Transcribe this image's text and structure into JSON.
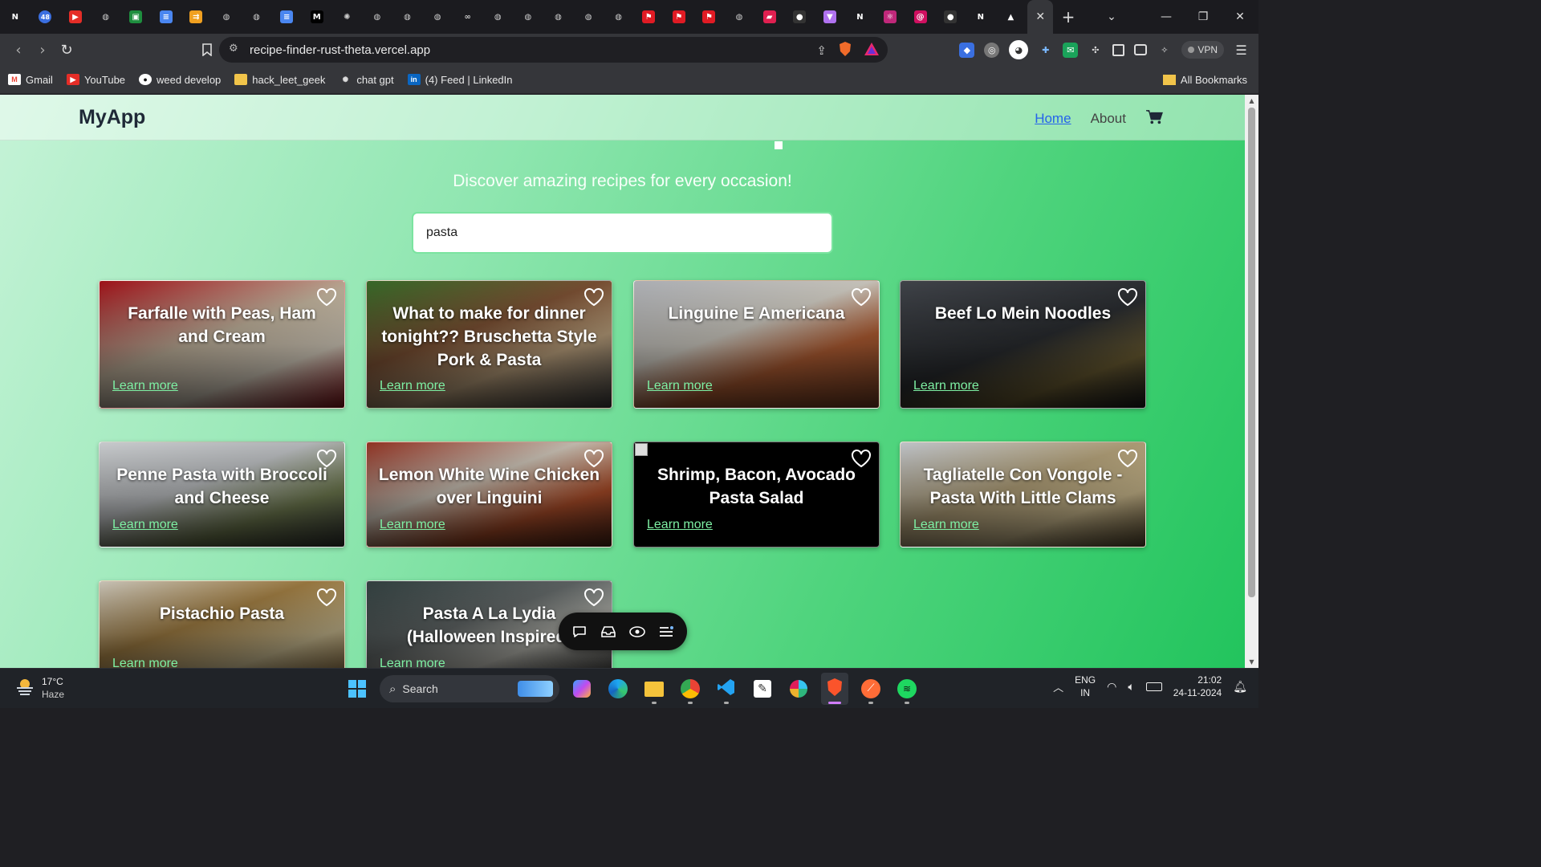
{
  "browser": {
    "tab_count": 35,
    "tabs_icons": [
      "notion-icon",
      "calendar-icon",
      "youtube-icon",
      "globe-icon",
      "classroom-icon",
      "docs-icon",
      "arrow-icon",
      "globe-icon",
      "globe-icon",
      "docs-icon",
      "medium-icon",
      "openai-icon",
      "globe-icon",
      "globe-icon",
      "globe-icon",
      "link-icon",
      "globe-icon",
      "globe-icon",
      "globe-icon",
      "globe-icon",
      "globe-icon",
      "gfg-icon",
      "gfg-icon",
      "gfg-icon",
      "globe-icon",
      "brand-icon",
      "github-icon",
      "vercel-v-icon",
      "notion-icon",
      "react-icon",
      "debian-icon",
      "github-icon",
      "notion-icon",
      "vercel-icon"
    ],
    "url": "recipe-finder-rust-theta.vercel.app",
    "vpn_label": "VPN",
    "bookmarks": [
      {
        "label": "Gmail",
        "icon": "gmail-icon"
      },
      {
        "label": "YouTube",
        "icon": "youtube-icon"
      },
      {
        "label": "weed develop",
        "icon": "github-icon"
      },
      {
        "label": "hack_leet_geek",
        "icon": "folder-icon"
      },
      {
        "label": "chat gpt",
        "icon": "openai-icon"
      },
      {
        "label": "(4) Feed | LinkedIn",
        "icon": "linkedin-icon"
      }
    ],
    "all_bookmarks": "All Bookmarks",
    "badge_count": "48"
  },
  "app": {
    "brand": "MyApp",
    "nav": {
      "home": "Home",
      "about": "About"
    },
    "tagline": "Discover amazing recipes for every occasion!",
    "search_value": "pasta",
    "learn_more": "Learn more",
    "recipes": [
      {
        "title": "Farfalle with Peas, Ham and Cream"
      },
      {
        "title": "What to make for dinner tonight?? Bruschetta Style Pork & Pasta"
      },
      {
        "title": "Linguine E Americana"
      },
      {
        "title": "Beef Lo Mein Noodles"
      },
      {
        "title": "Penne Pasta with Broccoli and Cheese"
      },
      {
        "title": "Lemon White Wine Chicken over Linguini"
      },
      {
        "title": "Shrimp, Bacon, Avocado Pasta Salad"
      },
      {
        "title": "Tagliatelle Con Vongole - Pasta With Little Clams"
      },
      {
        "title": "Pistachio Pasta"
      },
      {
        "title": "Pasta A La Lydia (Halloween Inspired)"
      }
    ]
  },
  "taskbar": {
    "temperature": "17°C",
    "weather": "Haze",
    "search_placeholder": "Search",
    "lang_top": "ENG",
    "lang_bottom": "IN",
    "time": "21:02",
    "date": "24-11-2024"
  }
}
